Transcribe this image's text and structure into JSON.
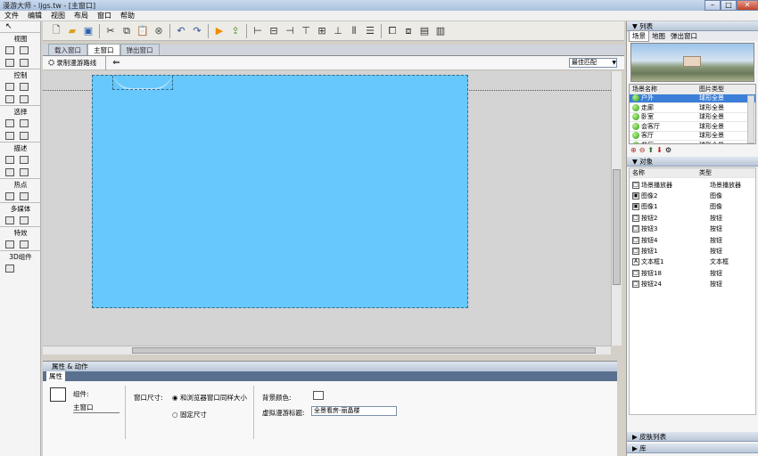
{
  "window": {
    "title": "漫游大师 - ljgs.tw - [主窗口]"
  },
  "menu": [
    "文件",
    "编辑",
    "视图",
    "布局",
    "窗口",
    "帮助"
  ],
  "left_sections": [
    {
      "label": "视图"
    },
    {
      "label": "控制"
    },
    {
      "label": "选择"
    },
    {
      "label": "描述"
    },
    {
      "label": "热点"
    },
    {
      "label": "多媒体"
    },
    {
      "label": "特效"
    },
    {
      "label": "3D组件"
    }
  ],
  "tabs": [
    {
      "label": "载入窗口",
      "active": false
    },
    {
      "label": "主窗口",
      "active": true
    },
    {
      "label": "弹出窗口",
      "active": false
    }
  ],
  "subbar": {
    "record_label": "录制漫游路线",
    "zoom_value": "最佳匹配"
  },
  "stage": {
    "color": "#66c8fc"
  },
  "props": {
    "header": "属性 & 动作",
    "tab": "属性",
    "component_label": "组件:",
    "component_value": "主窗口",
    "window_size_label": "窗口尺寸:",
    "opt1": "和浏览器窗口同样大小",
    "opt2": "固定尺寸",
    "bg_label": "背景颜色:",
    "title_label": "虚拟漫游标题:",
    "title_value": "全景看房-丽晶楼"
  },
  "right": {
    "list_header": "列表",
    "list_tabs": [
      "场景",
      "地图",
      "弹出窗口"
    ],
    "scene_cols": [
      "场景名称",
      "图片类型"
    ],
    "scenes": [
      {
        "name": "户外",
        "type": "球形全景",
        "selected": true
      },
      {
        "name": "走廊",
        "type": "球形全景",
        "selected": false
      },
      {
        "name": "卧室",
        "type": "球形全景",
        "selected": false
      },
      {
        "name": "会客厅",
        "type": "球形全景",
        "selected": false
      },
      {
        "name": "客厅",
        "type": "球形全景",
        "selected": false
      },
      {
        "name": "餐厅",
        "type": "球形全景",
        "selected": false
      }
    ],
    "obj_header": "对象",
    "obj_cols": [
      "名称",
      "类型"
    ],
    "objects": [
      {
        "name": "场景播放器",
        "type": "场景播放器"
      },
      {
        "name": "图像2",
        "type": "图像"
      },
      {
        "name": "图像1",
        "type": "图像"
      },
      {
        "name": "按钮2",
        "type": "按钮"
      },
      {
        "name": "按钮3",
        "type": "按钮"
      },
      {
        "name": "按钮4",
        "type": "按钮"
      },
      {
        "name": "按钮1",
        "type": "按钮"
      },
      {
        "name": "文本框1",
        "type": "文本框"
      },
      {
        "name": "按钮18",
        "type": "按钮"
      },
      {
        "name": "按钮24",
        "type": "按钮"
      }
    ],
    "skin_header": "皮肤列表",
    "lib_header": "库"
  }
}
